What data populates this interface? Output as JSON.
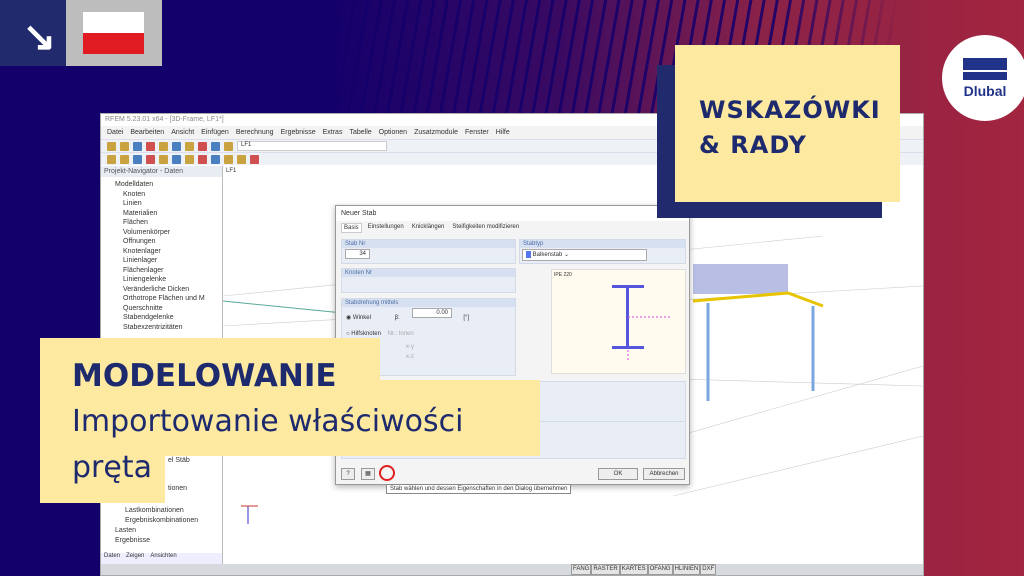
{
  "badge": {
    "arrow_icon": "arrow-down-right",
    "flag": "Poland",
    "colors": {
      "white": "#ffffff",
      "red": "#e01b22"
    }
  },
  "app": {
    "title": "RFEM 5.23.01 x64 - [3D-Frame, LF1*]",
    "menu": [
      "Datei",
      "Bearbeiten",
      "Ansicht",
      "Einfügen",
      "Berechnung",
      "Ergebnisse",
      "Extras",
      "Tabelle",
      "Optionen",
      "Zusatzmodule",
      "Fenster",
      "Hilfe"
    ],
    "loadcase": "LF1",
    "navigator": {
      "title": "Projekt-Navigator - Daten",
      "items": [
        "Modelldaten",
        "Knoten",
        "Linien",
        "Materialien",
        "Flächen",
        "Volumenkörper",
        "Öffnungen",
        "Knotenlager",
        "Linienlager",
        "Flächenlager",
        "Liniengelenke",
        "Veränderliche Dicken",
        "Orthotrope Flächen und M",
        "Querschnitte",
        "Stabendgelenke",
        "Stabexzentrizitäten"
      ],
      "lower_items": [
        "el Stäb",
        "tionen",
        "Lastkombinationen",
        "Ergebniskombinationen",
        "Lasten",
        "Ergebnisse"
      ],
      "tabs": [
        "Daten",
        "Zeigen",
        "Ansichten"
      ]
    },
    "viewport_label": "LF1",
    "status": [
      "FANG",
      "RASTER",
      "KARTES",
      "OFANG",
      "HLINIEN",
      "DXF"
    ]
  },
  "dialog": {
    "title": "Neuer Stab",
    "tabs": [
      "Basis",
      "Einstellungen",
      "Knicklängen",
      "Steifigkeiten modifizieren"
    ],
    "stab_nr_label": "Stab Nr",
    "stab_nr": "34",
    "knoten_label": "Knoten Nr",
    "stabtyp_label": "Stabtyp",
    "stabtyp": "Balkenstab",
    "section_name": "IPE 220",
    "drehung_label": "Stabdrehung mittels",
    "winkel": "Winkel",
    "beta": "β:",
    "beta_value": "0.00",
    "unit": "[°]",
    "hilfsknoten": "Hilfsknoten",
    "nr": "Nr.:",
    "innen": "Innen",
    "xy": "x-y",
    "xz": "x-z",
    "ok": "OK",
    "cancel": "Abbrechen",
    "tooltip": "Stab wählen und dessen Eigenschaften in den Dialog übernehmen"
  },
  "overlay": {
    "tips_line1": "WSKAZÓWKI",
    "tips_line2": "& RADY",
    "logo": "Dlubal",
    "title": "MODELOWANIE",
    "subtitle_line1": "Importowanie właściwości",
    "subtitle_line2": "pręta"
  }
}
